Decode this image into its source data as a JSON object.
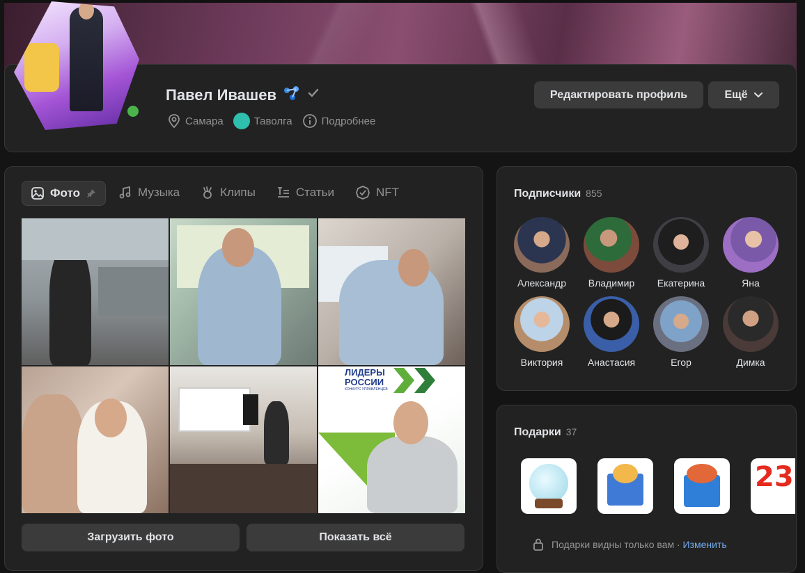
{
  "profile": {
    "name": "Павел Ивашев",
    "city": "Самара",
    "group": "Таволга",
    "details": "Подробнее",
    "edit_button": "Редактировать профиль",
    "more_button": "Ещё",
    "online": true
  },
  "media": {
    "tabs": [
      {
        "label": "Фото",
        "active": true,
        "icon": "image-icon"
      },
      {
        "label": "Музыка",
        "active": false,
        "icon": "music-note-icon"
      },
      {
        "label": "Клипы",
        "active": false,
        "icon": "clips-icon"
      },
      {
        "label": "Статьи",
        "active": false,
        "icon": "article-icon"
      },
      {
        "label": "NFT",
        "active": false,
        "icon": "nft-badge-icon"
      }
    ],
    "photo6_title": "ЛИДЕРЫ\nРОССИИ",
    "photo6_subtitle": "КОНКУРС УПРАВЛЕНЦЕВ",
    "upload_button": "Загрузить фото",
    "show_all_button": "Показать всё"
  },
  "followers": {
    "title": "Подписчики",
    "count": "855",
    "items": [
      {
        "name": "Александр",
        "color": "#8a6a5a"
      },
      {
        "name": "Владимир",
        "color": "#7c4b3b"
      },
      {
        "name": "Екатерина",
        "color": "#3e3e44"
      },
      {
        "name": "Яна",
        "color": "#9c6fc4"
      },
      {
        "name": "Виктория",
        "color": "#b58d6a"
      },
      {
        "name": "Анастасия",
        "color": "#3a5fa8"
      },
      {
        "name": "Егор",
        "color": "#6b7080"
      },
      {
        "name": "Димка",
        "color": "#4a3a38"
      }
    ]
  },
  "gifts": {
    "title": "Подарки",
    "count": "37",
    "note": "Подарки видны только вам ·",
    "change_link": "Изменить",
    "fourth_gift_text": "23"
  },
  "colors": {
    "accent": "#71aaeb",
    "online": "#4bb34b",
    "card_bg": "#222222",
    "button_bg": "#3b3b3b"
  }
}
